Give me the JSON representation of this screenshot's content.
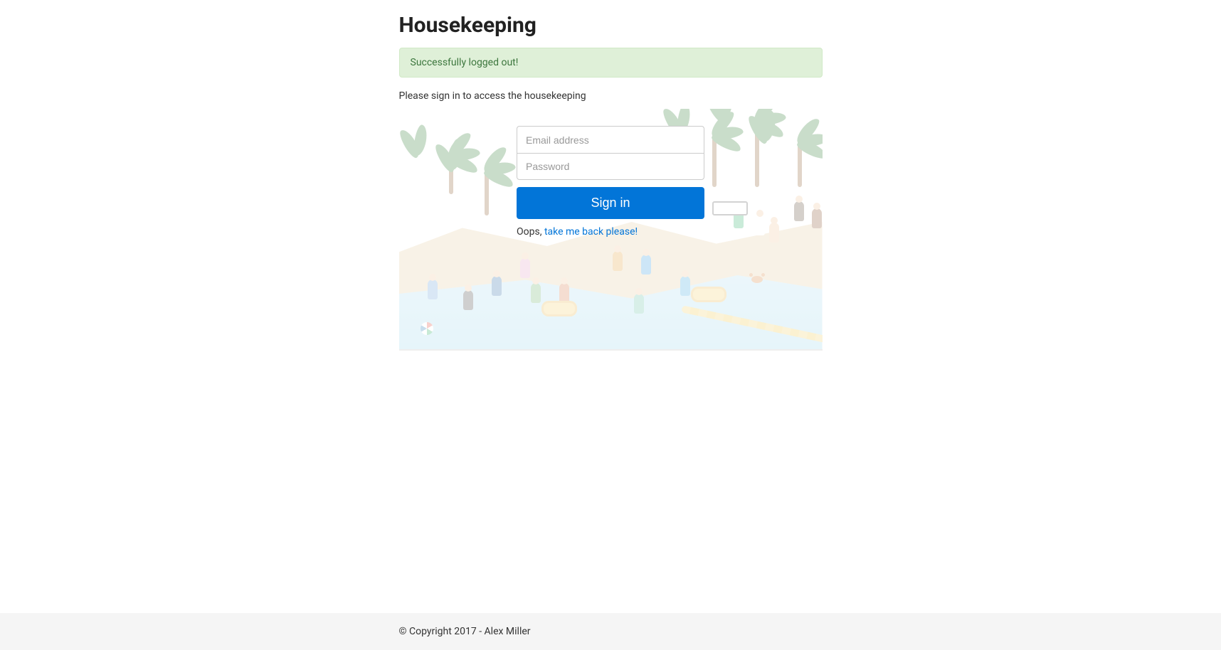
{
  "page_title": "Housekeeping",
  "alert": {
    "success_message": "Successfully logged out!"
  },
  "subtitle": "Please sign in to access the housekeeping",
  "form": {
    "email_placeholder": "Email address",
    "password_placeholder": "Password",
    "submit_label": "Sign in"
  },
  "back": {
    "prefix": "Oops, ",
    "link_text": "take me back please!"
  },
  "footer": {
    "copyright": "© Copyright 2017 - Alex Miller"
  }
}
